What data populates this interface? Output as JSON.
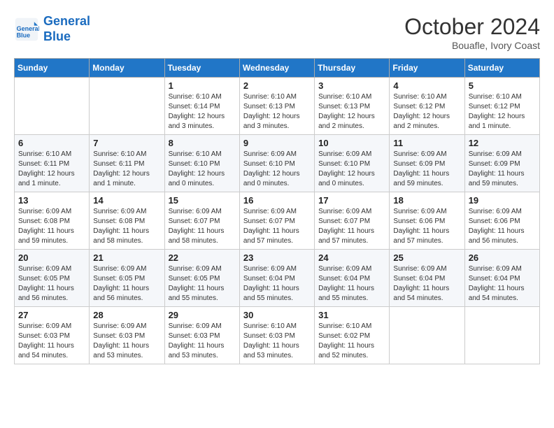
{
  "logo": {
    "line1": "General",
    "line2": "Blue"
  },
  "title": {
    "month_year": "October 2024",
    "location": "Bouafle, Ivory Coast"
  },
  "days_of_week": [
    "Sunday",
    "Monday",
    "Tuesday",
    "Wednesday",
    "Thursday",
    "Friday",
    "Saturday"
  ],
  "weeks": [
    [
      {
        "day": "",
        "info": ""
      },
      {
        "day": "",
        "info": ""
      },
      {
        "day": "1",
        "info": "Sunrise: 6:10 AM\nSunset: 6:14 PM\nDaylight: 12 hours\nand 3 minutes."
      },
      {
        "day": "2",
        "info": "Sunrise: 6:10 AM\nSunset: 6:13 PM\nDaylight: 12 hours\nand 3 minutes."
      },
      {
        "day": "3",
        "info": "Sunrise: 6:10 AM\nSunset: 6:13 PM\nDaylight: 12 hours\nand 2 minutes."
      },
      {
        "day": "4",
        "info": "Sunrise: 6:10 AM\nSunset: 6:12 PM\nDaylight: 12 hours\nand 2 minutes."
      },
      {
        "day": "5",
        "info": "Sunrise: 6:10 AM\nSunset: 6:12 PM\nDaylight: 12 hours\nand 1 minute."
      }
    ],
    [
      {
        "day": "6",
        "info": "Sunrise: 6:10 AM\nSunset: 6:11 PM\nDaylight: 12 hours\nand 1 minute."
      },
      {
        "day": "7",
        "info": "Sunrise: 6:10 AM\nSunset: 6:11 PM\nDaylight: 12 hours\nand 1 minute."
      },
      {
        "day": "8",
        "info": "Sunrise: 6:10 AM\nSunset: 6:10 PM\nDaylight: 12 hours\nand 0 minutes."
      },
      {
        "day": "9",
        "info": "Sunrise: 6:09 AM\nSunset: 6:10 PM\nDaylight: 12 hours\nand 0 minutes."
      },
      {
        "day": "10",
        "info": "Sunrise: 6:09 AM\nSunset: 6:10 PM\nDaylight: 12 hours\nand 0 minutes."
      },
      {
        "day": "11",
        "info": "Sunrise: 6:09 AM\nSunset: 6:09 PM\nDaylight: 11 hours\nand 59 minutes."
      },
      {
        "day": "12",
        "info": "Sunrise: 6:09 AM\nSunset: 6:09 PM\nDaylight: 11 hours\nand 59 minutes."
      }
    ],
    [
      {
        "day": "13",
        "info": "Sunrise: 6:09 AM\nSunset: 6:08 PM\nDaylight: 11 hours\nand 59 minutes."
      },
      {
        "day": "14",
        "info": "Sunrise: 6:09 AM\nSunset: 6:08 PM\nDaylight: 11 hours\nand 58 minutes."
      },
      {
        "day": "15",
        "info": "Sunrise: 6:09 AM\nSunset: 6:07 PM\nDaylight: 11 hours\nand 58 minutes."
      },
      {
        "day": "16",
        "info": "Sunrise: 6:09 AM\nSunset: 6:07 PM\nDaylight: 11 hours\nand 57 minutes."
      },
      {
        "day": "17",
        "info": "Sunrise: 6:09 AM\nSunset: 6:07 PM\nDaylight: 11 hours\nand 57 minutes."
      },
      {
        "day": "18",
        "info": "Sunrise: 6:09 AM\nSunset: 6:06 PM\nDaylight: 11 hours\nand 57 minutes."
      },
      {
        "day": "19",
        "info": "Sunrise: 6:09 AM\nSunset: 6:06 PM\nDaylight: 11 hours\nand 56 minutes."
      }
    ],
    [
      {
        "day": "20",
        "info": "Sunrise: 6:09 AM\nSunset: 6:05 PM\nDaylight: 11 hours\nand 56 minutes."
      },
      {
        "day": "21",
        "info": "Sunrise: 6:09 AM\nSunset: 6:05 PM\nDaylight: 11 hours\nand 56 minutes."
      },
      {
        "day": "22",
        "info": "Sunrise: 6:09 AM\nSunset: 6:05 PM\nDaylight: 11 hours\nand 55 minutes."
      },
      {
        "day": "23",
        "info": "Sunrise: 6:09 AM\nSunset: 6:04 PM\nDaylight: 11 hours\nand 55 minutes."
      },
      {
        "day": "24",
        "info": "Sunrise: 6:09 AM\nSunset: 6:04 PM\nDaylight: 11 hours\nand 55 minutes."
      },
      {
        "day": "25",
        "info": "Sunrise: 6:09 AM\nSunset: 6:04 PM\nDaylight: 11 hours\nand 54 minutes."
      },
      {
        "day": "26",
        "info": "Sunrise: 6:09 AM\nSunset: 6:04 PM\nDaylight: 11 hours\nand 54 minutes."
      }
    ],
    [
      {
        "day": "27",
        "info": "Sunrise: 6:09 AM\nSunset: 6:03 PM\nDaylight: 11 hours\nand 54 minutes."
      },
      {
        "day": "28",
        "info": "Sunrise: 6:09 AM\nSunset: 6:03 PM\nDaylight: 11 hours\nand 53 minutes."
      },
      {
        "day": "29",
        "info": "Sunrise: 6:09 AM\nSunset: 6:03 PM\nDaylight: 11 hours\nand 53 minutes."
      },
      {
        "day": "30",
        "info": "Sunrise: 6:10 AM\nSunset: 6:03 PM\nDaylight: 11 hours\nand 53 minutes."
      },
      {
        "day": "31",
        "info": "Sunrise: 6:10 AM\nSunset: 6:02 PM\nDaylight: 11 hours\nand 52 minutes."
      },
      {
        "day": "",
        "info": ""
      },
      {
        "day": "",
        "info": ""
      }
    ]
  ]
}
